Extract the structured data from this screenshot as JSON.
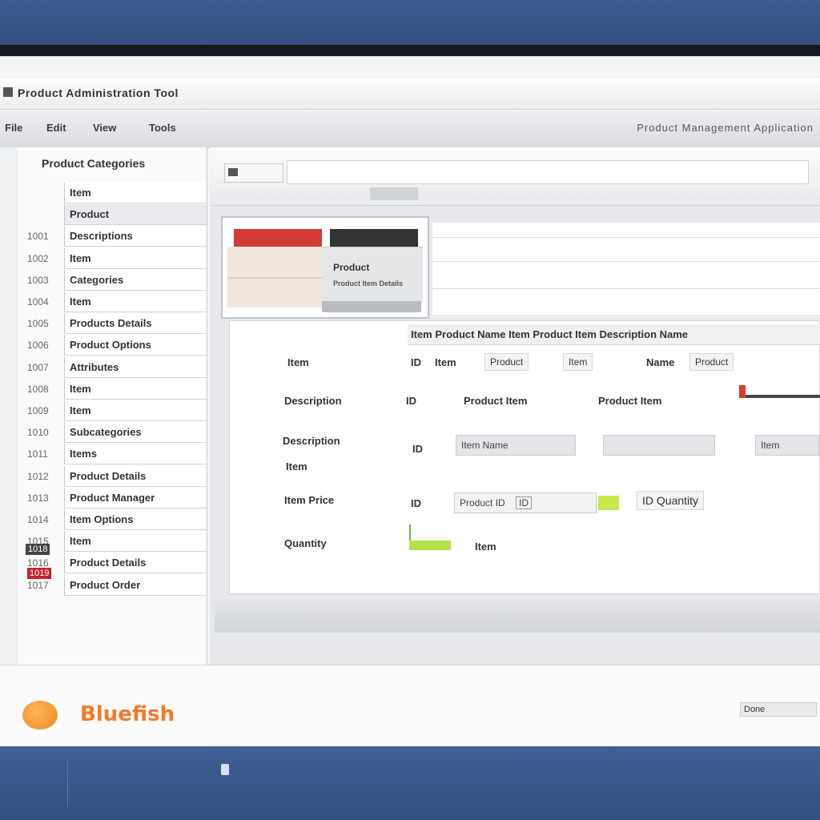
{
  "window": {
    "title": "Product Administration Tool"
  },
  "menubar": {
    "items": [
      "File",
      "Edit",
      "View",
      "Tools"
    ],
    "right_text": "Product Management Application"
  },
  "sidebar": {
    "header": "Product Categories",
    "items": [
      {
        "num": "",
        "label": "Item"
      },
      {
        "num": "",
        "label": "Product"
      },
      {
        "num": "1001",
        "label": "Descriptions"
      },
      {
        "num": "1002",
        "label": "Item"
      },
      {
        "num": "1003",
        "label": "Categories"
      },
      {
        "num": "1004",
        "label": "Item"
      },
      {
        "num": "1005",
        "label": "Products Details"
      },
      {
        "num": "1006",
        "label": "Product Options"
      },
      {
        "num": "1007",
        "label": "Attributes"
      },
      {
        "num": "1008",
        "label": "Item"
      },
      {
        "num": "1009",
        "label": "Item"
      },
      {
        "num": "1010",
        "label": "Subcategories"
      },
      {
        "num": "1011",
        "label": "Items"
      },
      {
        "num": "1012",
        "label": "Product Details"
      },
      {
        "num": "1013",
        "label": "Product Manager"
      },
      {
        "num": "1014",
        "label": "Item Options"
      },
      {
        "num": "1015",
        "label": "Item"
      },
      {
        "num": "1016",
        "label": "Product Details"
      },
      {
        "num": "1017",
        "label": "Product Order"
      }
    ],
    "badge_dark": "1018",
    "badge_red": "1019"
  },
  "content": {
    "tab_label": "",
    "preview": {
      "label": "Product",
      "sublabel": "Product Item Details"
    }
  },
  "form": {
    "header_text": "Item Product Name Item Product Item Description Name",
    "fields": [
      {
        "label": "Item",
        "values": [
          "ID",
          "Item",
          "Product",
          "Item",
          "Name",
          "Product"
        ]
      },
      {
        "label": "Description",
        "values": [
          "ID",
          "Product Item",
          "Product Item"
        ]
      },
      {
        "label": "Description",
        "label2": "Item",
        "values": [
          "ID"
        ],
        "input1": "Item Name",
        "input2": "",
        "input3": "Item"
      },
      {
        "label": "Item Price",
        "values": [
          "ID"
        ],
        "input1": "Product ID",
        "input_chip": "ID",
        "chip_right": "ID Quantity"
      },
      {
        "label": "Quantity",
        "values": [
          "Item"
        ]
      }
    ]
  },
  "footer": {
    "brand": "Bluefish",
    "right_text": "Done"
  },
  "colors": {
    "accent": "#f07b2a",
    "red": "#d43a36",
    "green": "#b6e04a",
    "taskbar": "#39568a"
  }
}
